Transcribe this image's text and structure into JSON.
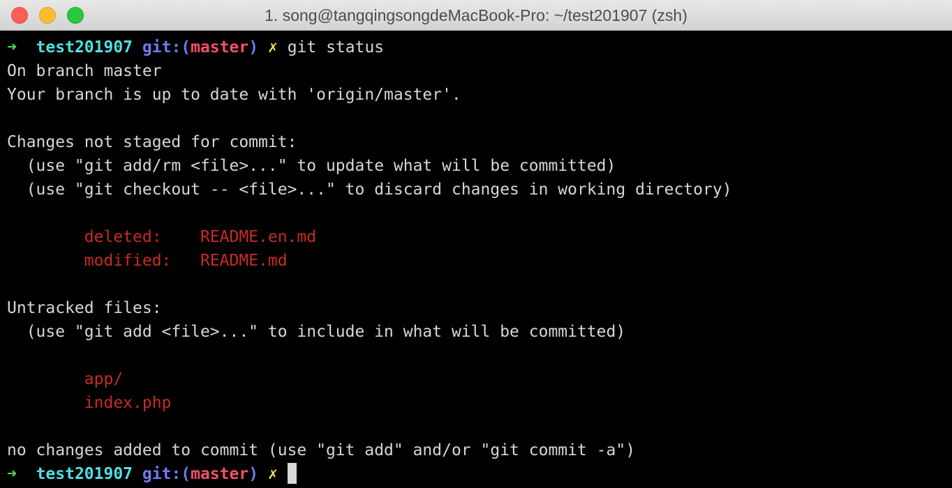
{
  "window": {
    "title": "1. song@tangqingsongdeMacBook-Pro: ~/test201907 (zsh)"
  },
  "colors": {
    "prompt_arrow": "#4ee14f",
    "prompt_dir": "#4fe0e3",
    "prompt_git": "#6f7bf1",
    "prompt_branch": "#f3506b",
    "prompt_dirty": "#f3e04f",
    "changed_files": "#c92a25",
    "background": "#000000",
    "text": "#d7d7d7"
  },
  "prompt": {
    "arrow": "➜",
    "dir": "test201907",
    "git_prefix": "git:(",
    "branch": "master",
    "git_suffix": ")",
    "dirty_mark": "✗"
  },
  "command": "git status",
  "output": {
    "on_branch": "On branch master",
    "up_to_date": "Your branch is up to date with 'origin/master'.",
    "changes_header": "Changes not staged for commit:",
    "hint_add_rm": "  (use \"git add/rm <file>...\" to update what will be committed)",
    "hint_checkout": "  (use \"git checkout -- <file>...\" to discard changes in working directory)",
    "changes": [
      {
        "status": "deleted:",
        "file": "README.en.md"
      },
      {
        "status": "modified:",
        "file": "README.md"
      }
    ],
    "untracked_header": "Untracked files:",
    "hint_untracked": "  (use \"git add <file>...\" to include in what will be committed)",
    "untracked": [
      "app/",
      "index.php"
    ],
    "summary": "no changes added to commit (use \"git add\" and/or \"git commit -a\")"
  }
}
